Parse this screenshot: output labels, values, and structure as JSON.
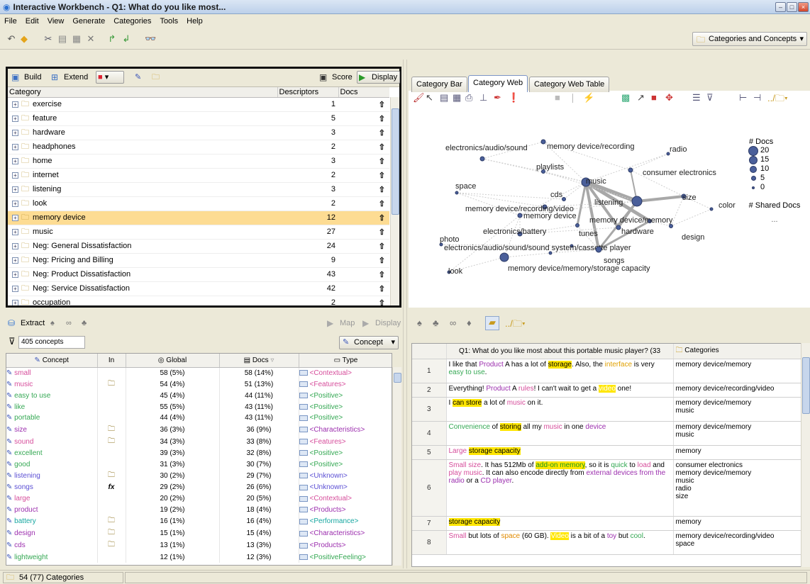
{
  "window": {
    "title": "Interactive Workbench - Q1: What do you like most..."
  },
  "menu": [
    "File",
    "Edit",
    "View",
    "Generate",
    "Categories",
    "Tools",
    "Help"
  ],
  "toolbar": {
    "view_selector": "Categories and Concepts"
  },
  "category_pane": {
    "build_label": "Build",
    "extend_label": "Extend",
    "score_label": "Score",
    "display_label": "Display",
    "columns": [
      "Category",
      "Descriptors",
      "Docs"
    ],
    "rows": [
      {
        "name": "exercise",
        "descriptors": "1"
      },
      {
        "name": "feature",
        "descriptors": "5"
      },
      {
        "name": "hardware",
        "descriptors": "3"
      },
      {
        "name": "headphones",
        "descriptors": "2"
      },
      {
        "name": "home",
        "descriptors": "3"
      },
      {
        "name": "internet",
        "descriptors": "2"
      },
      {
        "name": "listening",
        "descriptors": "3"
      },
      {
        "name": "look",
        "descriptors": "2"
      },
      {
        "name": "memory device",
        "descriptors": "12"
      },
      {
        "name": "music",
        "descriptors": "27"
      },
      {
        "name": "Neg: General Dissatisfaction",
        "descriptors": "24"
      },
      {
        "name": "Neg: Pricing and Billing",
        "descriptors": "9"
      },
      {
        "name": "Neg: Product Dissatisfaction",
        "descriptors": "43"
      },
      {
        "name": "Neg: Service Dissatisfaction",
        "descriptors": "42"
      },
      {
        "name": "occupation",
        "descriptors": "2"
      }
    ],
    "selected_index": 8
  },
  "concept_pane": {
    "extract_label": "Extract",
    "map_label": "Map",
    "display_label": "Display",
    "filter_value": "405 concepts",
    "concept_dropdown": "Concept",
    "columns": [
      "Concept",
      "In",
      "Global",
      "Docs",
      "Type"
    ],
    "rows": [
      {
        "concept": "small",
        "in": "",
        "global": "58 (5%)",
        "docs": "58 (14%)",
        "type": "<Contextual>",
        "color": "pink"
      },
      {
        "concept": "music",
        "in": "cat",
        "global": "54 (4%)",
        "docs": "51 (13%)",
        "type": "<Features>",
        "color": "pink"
      },
      {
        "concept": "easy to use",
        "in": "",
        "global": "45 (4%)",
        "docs": "44 (11%)",
        "type": "<Positive>",
        "color": "green"
      },
      {
        "concept": "like",
        "in": "",
        "global": "55 (5%)",
        "docs": "43 (11%)",
        "type": "<Positive>",
        "color": "green"
      },
      {
        "concept": "portable",
        "in": "",
        "global": "44 (4%)",
        "docs": "43 (11%)",
        "type": "<Positive>",
        "color": "green"
      },
      {
        "concept": "size",
        "in": "cat",
        "global": "36 (3%)",
        "docs": "36 (9%)",
        "type": "<Characteristics>",
        "color": "purple"
      },
      {
        "concept": "sound",
        "in": "cat",
        "global": "34 (3%)",
        "docs": "33 (8%)",
        "type": "<Features>",
        "color": "pink"
      },
      {
        "concept": "excellent",
        "in": "",
        "global": "39 (3%)",
        "docs": "32 (8%)",
        "type": "<Positive>",
        "color": "green"
      },
      {
        "concept": "good",
        "in": "",
        "global": "31 (3%)",
        "docs": "30 (7%)",
        "type": "<Positive>",
        "color": "green"
      },
      {
        "concept": "listening",
        "in": "cat",
        "global": "30 (2%)",
        "docs": "29 (7%)",
        "type": "<Unknown>",
        "color": "blue"
      },
      {
        "concept": "songs",
        "in": "fx",
        "global": "29 (2%)",
        "docs": "26 (6%)",
        "type": "<Unknown>",
        "color": "blue"
      },
      {
        "concept": "large",
        "in": "",
        "global": "20 (2%)",
        "docs": "20 (5%)",
        "type": "<Contextual>",
        "color": "pink"
      },
      {
        "concept": "product",
        "in": "",
        "global": "19 (2%)",
        "docs": "18 (4%)",
        "type": "<Products>",
        "color": "purple"
      },
      {
        "concept": "battery",
        "in": "cat",
        "global": "16 (1%)",
        "docs": "16 (4%)",
        "type": "<Performance>",
        "color": "teal"
      },
      {
        "concept": "design",
        "in": "cat",
        "global": "15 (1%)",
        "docs": "15 (4%)",
        "type": "<Characteristics>",
        "color": "purple"
      },
      {
        "concept": "cds",
        "in": "cat",
        "global": "13 (1%)",
        "docs": "13 (3%)",
        "type": "<Products>",
        "color": "purple"
      },
      {
        "concept": "lightweight",
        "in": "",
        "global": "12 (1%)",
        "docs": "12 (3%)",
        "type": "<PositiveFeeling>",
        "color": "green"
      }
    ]
  },
  "viz_pane": {
    "tabs": [
      "Category Bar",
      "Category Web",
      "Category Web Table"
    ],
    "active_tab": 1,
    "legend": {
      "docs_title": "# Docs",
      "docs_values": [
        "20",
        "15",
        "10",
        "5",
        "0"
      ],
      "shared_title": "# Shared Docs",
      "more": "..."
    },
    "web_labels": [
      "electronics/audio/sound",
      "memory device/recording",
      "radio",
      "playlists",
      "music",
      "consumer electronics",
      "space",
      "cds",
      "size",
      "color",
      "memory device/recording/video",
      "listening",
      "memory device",
      "memory device/memory",
      "electronics/battery",
      "tunes",
      "hardware",
      "design",
      "photo",
      "electronics/audio/sound/sound system/cassette player",
      "songs",
      "memory device/memory/storage capacity",
      "look"
    ]
  },
  "data_pane": {
    "column_header": "Q1: What do you like most about this portable music player? (33",
    "categories_header": "Categories",
    "rows": [
      {
        "n": "1",
        "text_html": "I like that Product A has a lot of storage. Also, the interface is very easy to use.",
        "cats": [
          "memory device/memory"
        ]
      },
      {
        "n": "2",
        "text_html": "Everything! Product A rules! I can't wait to get a video one!",
        "cats": [
          "memory device/recording/video"
        ]
      },
      {
        "n": "3",
        "text_html": "I can store a lot of music on it.",
        "cats": [
          "memory device/memory",
          "music"
        ]
      },
      {
        "n": "4",
        "text_html": "Convenience of storing all my music in one device",
        "cats": [
          "memory device/memory",
          "music"
        ]
      },
      {
        "n": "5",
        "text_html": "Large storage capacity",
        "cats": [
          "memory"
        ]
      },
      {
        "n": "6",
        "text_html": "Small size. It has 512Mb of add-on memory, so it is quick to load and play music. It can also encode directly from external devices from the radio or a CD player.",
        "cats": [
          "consumer electronics",
          "memory device/memory",
          "music",
          "radio",
          "size"
        ]
      },
      {
        "n": "7",
        "text_html": "storage capacity",
        "cats": [
          "memory"
        ]
      },
      {
        "n": "8",
        "text_html": "Small but lots of space (60 GB). Video is a bit of a toy but cool.",
        "cats": [
          "memory device/recording/video",
          "space"
        ]
      }
    ]
  },
  "status": {
    "count": "54 (77) Categories"
  }
}
